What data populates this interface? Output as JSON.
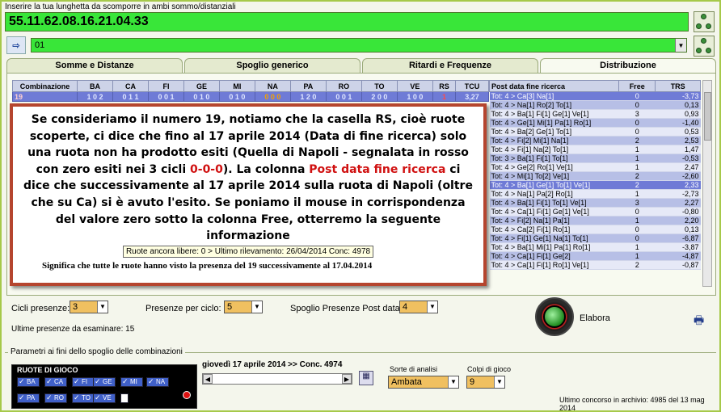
{
  "header": {
    "instruction": "Inserire la tua lunghetta da scomporre in ambi sommo/distanziali",
    "lunghetta": "55.11.62.08.16.21.04.33",
    "selected": "01"
  },
  "tabs": [
    "Somme e Distanze",
    "Spoglio generico",
    "Ritardi e Frequenze",
    "Distribuzione"
  ],
  "grid": {
    "headers": [
      "Combinazione",
      "BA",
      "CA",
      "FI",
      "GE",
      "MI",
      "NA",
      "PA",
      "RO",
      "TO",
      "VE",
      "RS",
      "TCU"
    ],
    "row": [
      "19",
      "1 0 2",
      "0 1 1",
      "0 0 1",
      "0 1 0",
      "0 1 0",
      "0 0 0",
      "1 2 0",
      "0 0 1",
      "2 0 0",
      "1 0 0",
      "1",
      "3,27"
    ]
  },
  "post_grid": {
    "headers": [
      "Post data fine ricerca",
      "Free",
      "TRS"
    ],
    "rows": [
      [
        "Tot: 4 > Ca[3] Na[1]",
        "0",
        "-3,73"
      ],
      [
        "Tot: 4 > Na[1] Ro[2] To[1]",
        "0",
        "0,13"
      ],
      [
        "Tot: 4 > Ba[1] Fi[1] Ge[1] Ve[1]",
        "3",
        "0,93"
      ],
      [
        "Tot: 4 > Ge[1] Mi[1] Pa[1] Ro[1]",
        "0",
        "-1,40"
      ],
      [
        "Tot: 4 > Ba[2] Ge[1] To[1]",
        "0",
        "0,53"
      ],
      [
        "Tot: 4 > Fi[2] Mi[1] Na[1]",
        "2",
        "2,53"
      ],
      [
        "Tot: 4 > Fi[1] Na[2] To[1]",
        "1",
        "1,47"
      ],
      [
        "Tot: 3 > Ba[1] Fi[1] To[1]",
        "1",
        "-0,53"
      ],
      [
        "Tot: 4 > Ge[2] Ro[1] Ve[1]",
        "1",
        "2,47"
      ],
      [
        "Tot: 4 > Mi[1] To[2] Ve[1]",
        "2",
        "-2,60"
      ],
      [
        "Tot: 4 > Ba[1] Ge[1] To[1] Ve[1]",
        "2",
        "2,33"
      ],
      [
        "Tot: 4 > Na[1] Pa[2] Ro[1]",
        "1",
        "-2,73"
      ],
      [
        "Tot: 4 > Ba[1] Fi[1] To[1] Ve[1]",
        "3",
        "2,27"
      ],
      [
        "Tot: 4 > Ca[1] Fi[1] Ge[1] Ve[1]",
        "0",
        "-0,80"
      ],
      [
        "Tot: 4 > Fi[2] Na[1] Pa[1]",
        "1",
        "2,20"
      ],
      [
        "Tot: 4 > Ca[2] Fi[1] Ro[1]",
        "0",
        "0,13"
      ],
      [
        "Tot: 4 > Fi[1] Ge[1] Na[1] To[1]",
        "0",
        "-6,87"
      ],
      [
        "Tot: 4 > Ba[1] Mi[1] Pa[1] Ro[1]",
        "1",
        "-3,87"
      ],
      [
        "Tot: 4 > Ca[1] Fi[1] Ge[2]",
        "1",
        "-4,87"
      ],
      [
        "Tot: 4 > Ca[1] Fi[1] Ro[1] Ve[1]",
        "2",
        "-0,87"
      ]
    ]
  },
  "popup": {
    "p1": "Se consideriamo il numero 19, notiamo che la casella RS, cioè ruote scoperte, ci dice che fino al 17 aprile 2014 (Data di fine ricerca) solo una ruota non ha prodotto esiti (Quella di Napoli  - segnalata in rosso con zero esiti nei 3 cicli ",
    "p1_red": "0-0-0",
    "p1_end": "). La colonna ",
    "p2_red": "Post data fine ricerca",
    "p2": " ci dice che successivamente al 17 aprile 2014 sulla ruota di Napoli (oltre che su Ca) si è avuto l'esito. Se poniamo il mouse in corrispondenza del valore zero sotto la colonna Free, otterremo la seguente informazione",
    "tooltip": "Ruote ancora libere:  0 > Ultimo rilevamento: 26/04/2014 Conc: 4978",
    "note": "Significa che tutte le ruote hanno visto la presenza del 19 successivamente al 17.04.2014"
  },
  "controls": {
    "cicli_label": "Cicli presenze:",
    "cicli_value": "3",
    "presenze_label": "Presenze per ciclo:",
    "presenze_value": "5",
    "spoglio_label": "Spoglio Presenze Post data:",
    "spoglio_value": "4",
    "ultime_label": "Ultime presenze da esaminare: 15",
    "elabora": "Elabora"
  },
  "params": {
    "legend": "Parametri ai fini dello spoglio delle combinazioni",
    "ruote_title": "RUOTE DI GIOCO",
    "ruote": [
      "BA",
      "CA",
      "FI",
      "GE",
      "MI",
      "NA",
      "PA",
      "RO",
      "TO",
      "VE"
    ],
    "date": "giovedì 17 aprile 2014 >> Conc. 4974",
    "sorte_label": "Sorte di analisi",
    "sorte_value": "Ambata",
    "colpi_label": "Colpi di gioco",
    "colpi_value": "9",
    "status": "Ultimo concorso in archivio: 4985 del 13 mag 2014"
  },
  "colors": {
    "green_field": "#39e639",
    "grid_blue": "#6f7bd6",
    "popup_border": "#b5452e",
    "red_text": "#d01010"
  }
}
